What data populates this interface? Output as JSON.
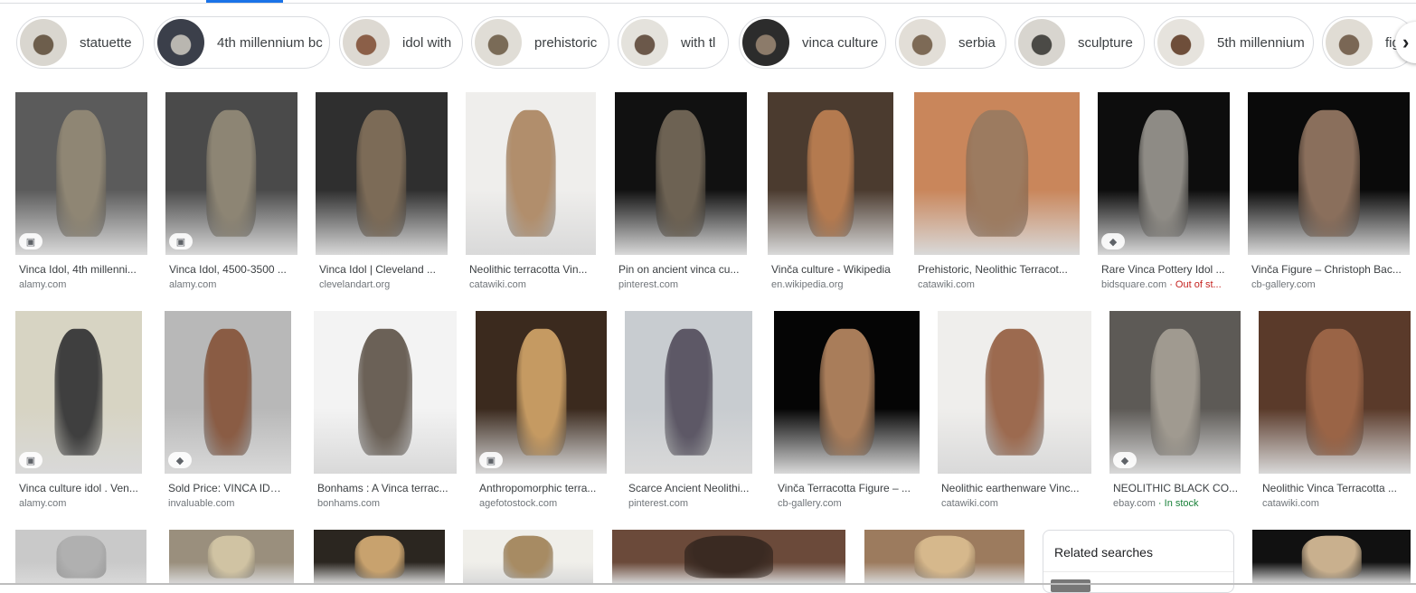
{
  "chips": [
    {
      "label": "statuette",
      "colors": [
        "#d9d6cf",
        "#6d5e4c"
      ]
    },
    {
      "label": "4th millennium bc",
      "colors": [
        "#3b3f4a",
        "#b9b6b0"
      ]
    },
    {
      "label": "idol with",
      "colors": [
        "#ddd9d2",
        "#8b5f48"
      ]
    },
    {
      "label": "prehistoric",
      "colors": [
        "#e0ddd6",
        "#7a6b57"
      ]
    },
    {
      "label": "with tl",
      "colors": [
        "#e4e2dc",
        "#6b584a"
      ]
    },
    {
      "label": "vinca culture",
      "colors": [
        "#2c2c2c",
        "#8c7b6a"
      ]
    },
    {
      "label": "serbia",
      "colors": [
        "#e2ded7",
        "#7d6a56"
      ]
    },
    {
      "label": "sculpture",
      "colors": [
        "#d8d5cf",
        "#4b4a46"
      ]
    },
    {
      "label": "5th millennium",
      "colors": [
        "#e6e3dd",
        "#6e4e3a"
      ]
    },
    {
      "label": "fig",
      "colors": [
        "#e0dcd4",
        "#7a6755"
      ]
    }
  ],
  "row1": [
    {
      "title": "Vinca Idol, 4th millenni...",
      "source": "alamy.com",
      "badge": "image-icon",
      "colors": [
        "#5b5b5b",
        "#8f8674"
      ]
    },
    {
      "title": "Vinca Idol, 4500-3500 ...",
      "source": "alamy.com",
      "badge": "image-icon",
      "colors": [
        "#4a4a4a",
        "#8d8574"
      ]
    },
    {
      "title": "Vinca Idol | Cleveland ...",
      "source": "clevelandart.org",
      "colors": [
        "#2f2f2f",
        "#7c6b57"
      ]
    },
    {
      "title": "Neolithic terracotta Vin...",
      "source": "catawiki.com",
      "colors": [
        "#efeeec",
        "#b18e6c"
      ]
    },
    {
      "title": "Pin on ancient vinca cu...",
      "source": "pinterest.com",
      "colors": [
        "#111111",
        "#6d6253"
      ]
    },
    {
      "title": "Vinča culture - Wikipedia",
      "source": "en.wikipedia.org",
      "colors": [
        "#4b3b2f",
        "#b47a4f"
      ]
    },
    {
      "title": "Prehistoric, Neolithic Terracot...",
      "source": "catawiki.com",
      "colors": [
        "#c9865b",
        "#9c7b60"
      ]
    },
    {
      "title": "Rare Vinca Pottery Idol ...",
      "source": "bidsquare.com",
      "source_extra": " · Out of st...",
      "extra_style": "red",
      "badge": "tag-icon",
      "colors": [
        "#0d0d0d",
        "#8e8b85"
      ]
    },
    {
      "title": "Vinča Figure – Christoph Bac...",
      "source": "cb-gallery.com",
      "colors": [
        "#0a0a0a",
        "#8a6f5c"
      ]
    }
  ],
  "row2": [
    {
      "title": "Vinca culture idol . Ven...",
      "source": "alamy.com",
      "badge": "image-icon",
      "colors": [
        "#d7d4c3",
        "#3f3f3f"
      ]
    },
    {
      "title": "Sold Price: VINCA IDOL...",
      "source": "invaluable.com",
      "badge": "tag-icon",
      "colors": [
        "#b8b8b8",
        "#8a5c44"
      ]
    },
    {
      "title": "Bonhams : A Vinca terrac...",
      "source": "bonhams.com",
      "colors": [
        "#f3f3f3",
        "#6b6157"
      ]
    },
    {
      "title": "Anthropomorphic terra...",
      "source": "agefotostock.com",
      "badge": "image-icon",
      "colors": [
        "#3b2a1e",
        "#c59a62"
      ]
    },
    {
      "title": "Scarce Ancient Neolithi...",
      "source": "pinterest.com",
      "colors": [
        "#c8ccd0",
        "#5d5866"
      ]
    },
    {
      "title": "Vinča Terracotta Figure – ...",
      "source": "cb-gallery.com",
      "colors": [
        "#050505",
        "#a97d5a"
      ]
    },
    {
      "title": "Neolithic earthenware Vinc...",
      "source": "catawiki.com",
      "colors": [
        "#efeeec",
        "#9c6a4f"
      ]
    },
    {
      "title": "NEOLITHIC BLACK CO...",
      "source": "ebay.com",
      "source_extra": " · In stock",
      "extra_style": "green",
      "badge": "tag-icon",
      "colors": [
        "#5d5a56",
        "#a09a90"
      ]
    },
    {
      "title": "Neolithic Vinca Terracotta ...",
      "source": "catawiki.com",
      "colors": [
        "#5a3a2a",
        "#9a6446"
      ]
    }
  ],
  "row3": [
    {
      "colors": [
        "#c9c9c9",
        "#b0b0b0"
      ]
    },
    {
      "colors": [
        "#9a8f7d",
        "#d0c3a3"
      ]
    },
    {
      "colors": [
        "#2b2620",
        "#c8a26e"
      ]
    },
    {
      "colors": [
        "#f0efea",
        "#a78b63"
      ]
    },
    {
      "colors": [
        "#6b4a3a",
        "#3a2a22"
      ]
    },
    {
      "colors": [
        "#9c7b5e",
        "#d6b88c"
      ]
    },
    {
      "colors": [
        "#111111",
        "#c9b08e"
      ]
    }
  ],
  "related": {
    "title": "Related searches"
  },
  "icons": {
    "next": "›"
  }
}
